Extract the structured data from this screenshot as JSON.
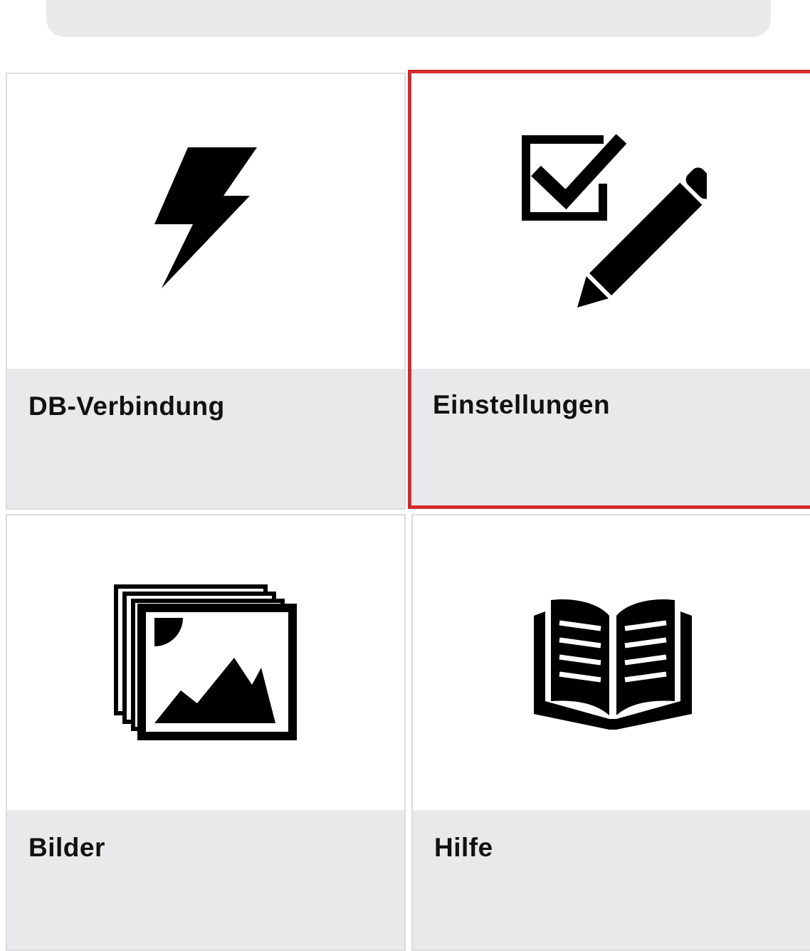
{
  "top_bar": {},
  "tiles": [
    {
      "label": "DB-Verbindung",
      "icon": "lightning-bolt-icon"
    },
    {
      "label": "Einstellungen",
      "icon": "checkbox-pencil-icon",
      "selected": true
    },
    {
      "label": "Bilder",
      "icon": "image-stack-icon"
    },
    {
      "label": "Hilfe",
      "icon": "open-book-icon"
    }
  ],
  "colors": {
    "selection_border": "#d42a2f",
    "label_background": "#e9e9eb",
    "icon": "#000000"
  }
}
